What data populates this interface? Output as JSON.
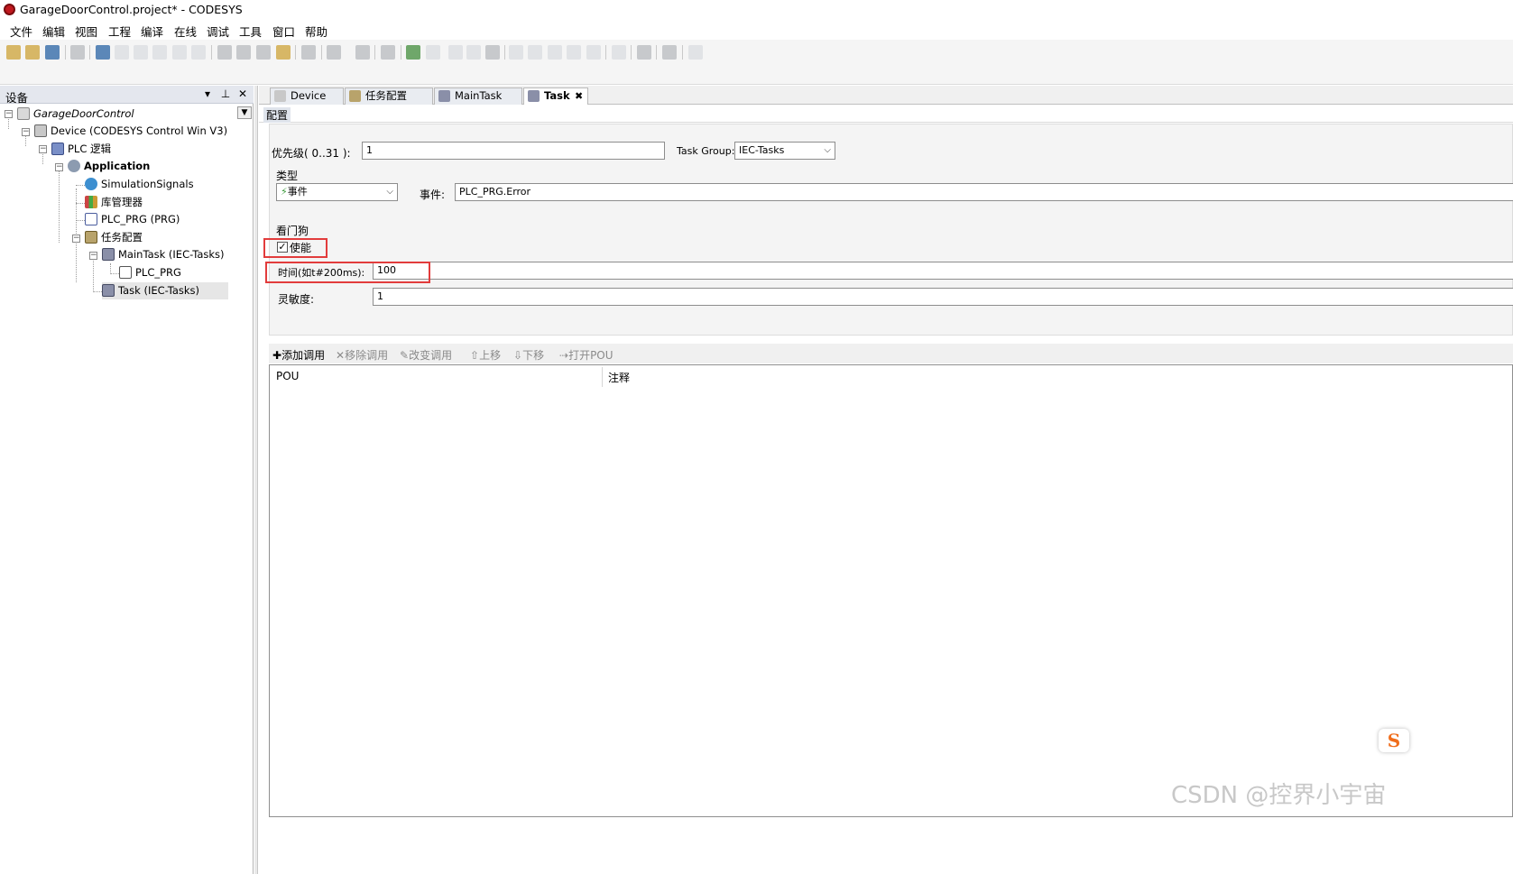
{
  "window": {
    "title": "GarageDoorControl.project* - CODESYS"
  },
  "menu": [
    "文件",
    "编辑",
    "视图",
    "工程",
    "编译",
    "在线",
    "调试",
    "工具",
    "窗口",
    "帮助"
  ],
  "devices_panel": {
    "title": "设备",
    "tree": [
      {
        "label": "GarageDoorControl"
      },
      {
        "label": "Device (CODESYS Control Win V3)"
      },
      {
        "label": "PLC 逻辑"
      },
      {
        "label": "Application"
      },
      {
        "label": "SimulationSignals"
      },
      {
        "label": "库管理器"
      },
      {
        "label": "PLC_PRG (PRG)"
      },
      {
        "label": "任务配置"
      },
      {
        "label": "MainTask (IEC-Tasks)"
      },
      {
        "label": "PLC_PRG"
      },
      {
        "label": "Task (IEC-Tasks)"
      }
    ]
  },
  "tabs": [
    {
      "label": "Device"
    },
    {
      "label": "任务配置"
    },
    {
      "label": "MainTask"
    },
    {
      "label": "Task"
    }
  ],
  "config": {
    "tab_label": "配置",
    "priority_label": "优先级( 0..31 ):",
    "priority_value": "1",
    "task_group_label": "Task Group:",
    "task_group_value": "IEC-Tasks",
    "type_group_label": "类型",
    "type_value": "事件",
    "event_label": "事件:",
    "event_value": "PLC_PRG.Error",
    "watchdog_label": "看门狗",
    "enable_label": "使能",
    "time_label": "时间(如t#200ms):",
    "time_value": "100",
    "sensitivity_label": "灵敏度:",
    "sensitivity_value": "1"
  },
  "call_toolbar": {
    "add": "添加调用",
    "remove": "移除调用",
    "change": "改变调用",
    "up": "上移",
    "down": "下移",
    "open": "打开POU"
  },
  "grid": {
    "columns": [
      "POU",
      "注释"
    ]
  },
  "watermark": "CSDN @控界小宇宙",
  "csdn_badge": "S",
  "colors": {
    "highlight_red": "#e23c3c",
    "panel_header": "#e4e7ee"
  }
}
